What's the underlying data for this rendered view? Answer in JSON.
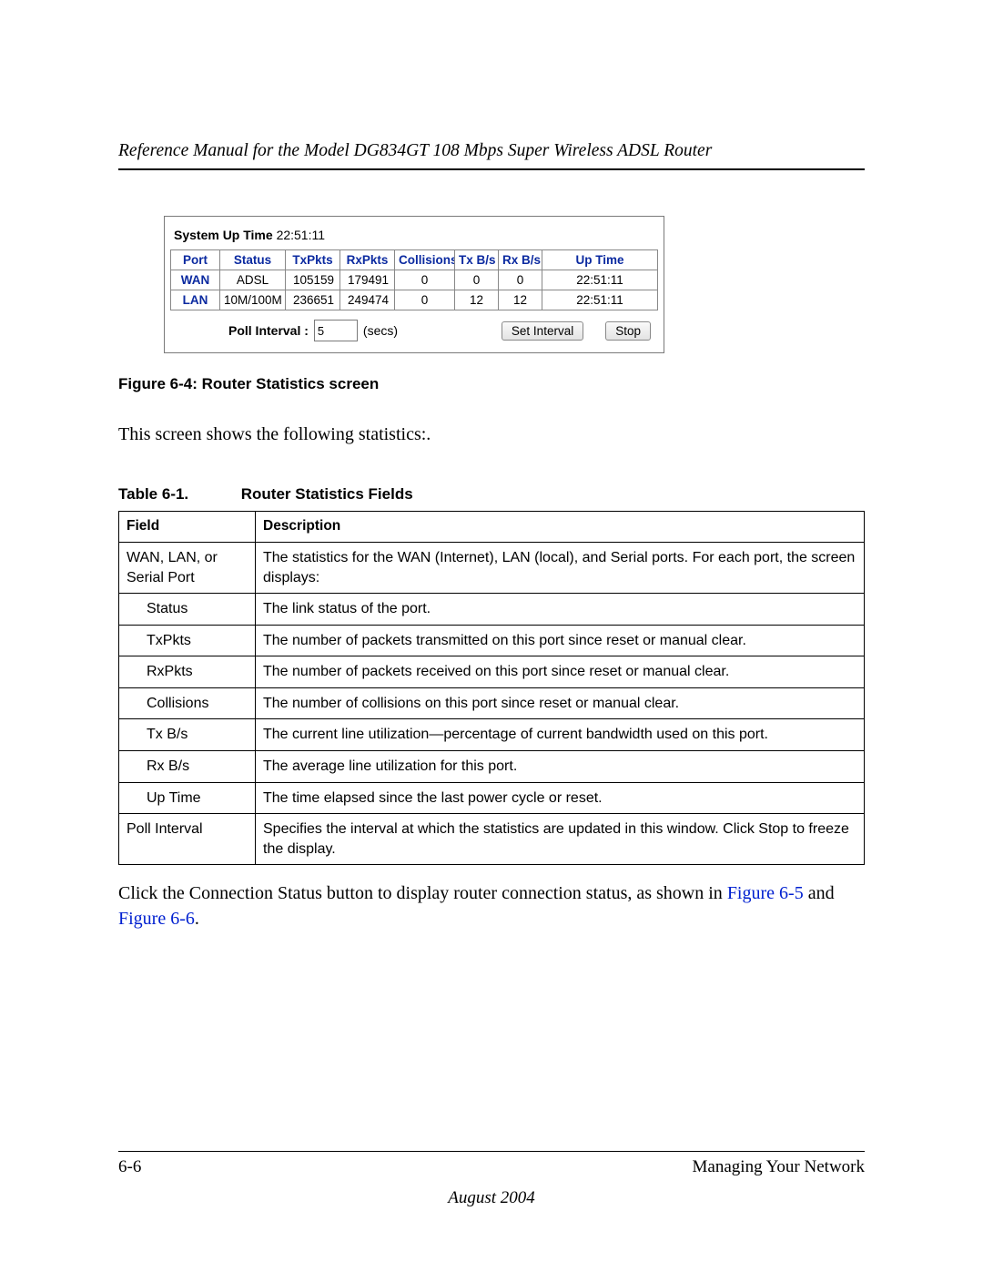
{
  "header": {
    "title": "Reference Manual for the Model DG834GT 108 Mbps Super Wireless ADSL Router"
  },
  "screenshot": {
    "system_uptime_label": "System Up Time",
    "system_uptime_value": "22:51:11",
    "headers": {
      "port": "Port",
      "status": "Status",
      "txpkts": "TxPkts",
      "rxpkts": "RxPkts",
      "collisions": "Collisions",
      "txbs": "Tx B/s",
      "rxbs": "Rx B/s",
      "uptime": "Up Time"
    },
    "rows": [
      {
        "port": "WAN",
        "status": "ADSL",
        "txpkts": "105159",
        "rxpkts": "179491",
        "collisions": "0",
        "txbs": "0",
        "rxbs": "0",
        "uptime": "22:51:11"
      },
      {
        "port": "LAN",
        "status": "10M/100M",
        "txpkts": "236651",
        "rxpkts": "249474",
        "collisions": "0",
        "txbs": "12",
        "rxbs": "12",
        "uptime": "22:51:11"
      }
    ],
    "poll_label": "Poll Interval :",
    "poll_value": "5",
    "secs_label": "(secs)",
    "set_interval": "Set Interval",
    "stop": "Stop"
  },
  "fig_caption": "Figure 6-4:  Router Statistics screen",
  "para1": "This screen shows the following statistics:.",
  "table_caption_num": "Table 6-1.",
  "table_caption_title": "Router Statistics Fields",
  "fields": {
    "h_field": "Field",
    "h_desc": "Description",
    "rows": [
      {
        "f": "WAN, LAN, or Serial Port",
        "indent": 0,
        "d": "The statistics for the WAN (Internet), LAN (local), and Serial ports. For each port, the screen displays:"
      },
      {
        "f": "Status",
        "indent": 1,
        "d": "The link status of the port."
      },
      {
        "f": "TxPkts",
        "indent": 1,
        "d": "The number of packets transmitted on this port since reset or manual clear."
      },
      {
        "f": "RxPkts",
        "indent": 1,
        "d": "The number of packets received on this port since reset or manual clear."
      },
      {
        "f": "Collisions",
        "indent": 1,
        "d": "The number of collisions on this port since reset or manual clear."
      },
      {
        "f": "Tx B/s",
        "indent": 1,
        "d": "The current line utilization—percentage of current bandwidth used on this port."
      },
      {
        "f": "Rx B/s",
        "indent": 1,
        "d": "The average line utilization for this port."
      },
      {
        "f": "Up Time",
        "indent": 1,
        "d": "The time elapsed since the last power cycle or reset."
      },
      {
        "f": "Poll Interval",
        "indent": 0,
        "d": "Specifies the interval at which the statistics are updated in this window. Click Stop to freeze the display."
      }
    ]
  },
  "para2_a": "Click the Connection Status button to display router connection status, as shown in ",
  "para2_link1": "Figure 6-5",
  "para2_b": " and ",
  "para2_link2": "Figure 6-6",
  "para2_c": ".",
  "footer": {
    "page": "6-6",
    "section": "Managing Your Network",
    "date": "August 2004"
  }
}
